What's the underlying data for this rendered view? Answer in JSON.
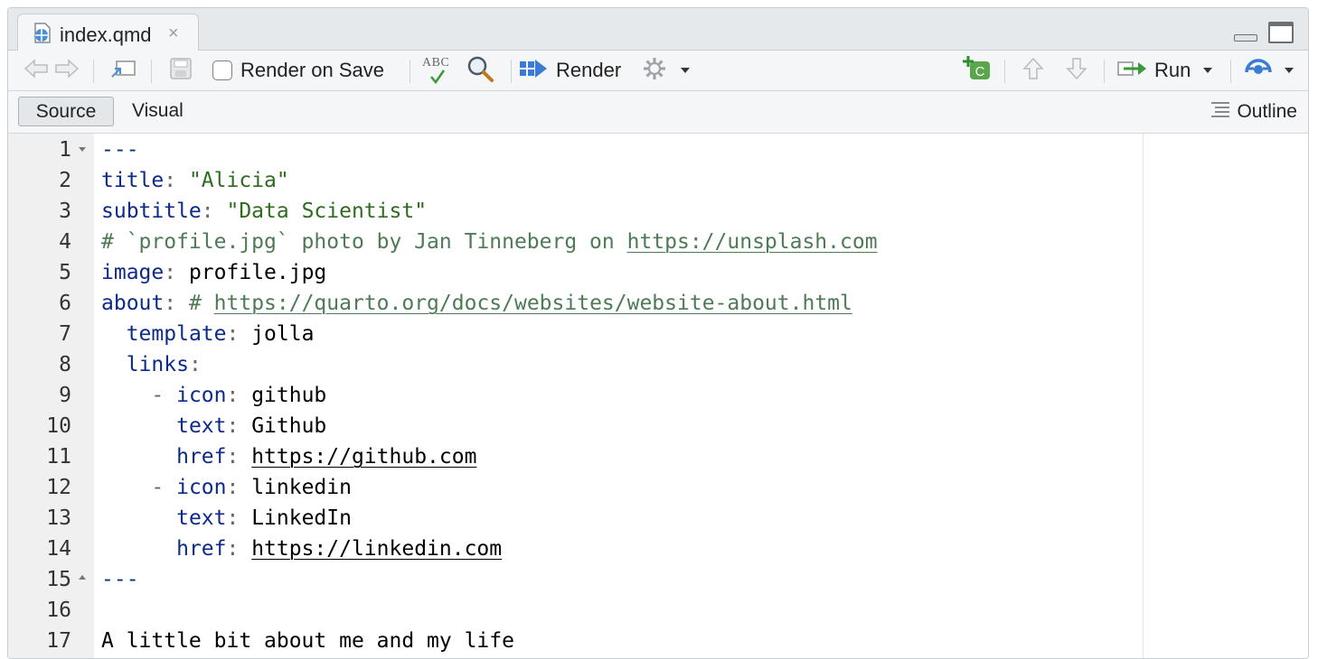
{
  "tab": {
    "title": "index.qmd",
    "close": "×"
  },
  "toolbar": {
    "render_on_save": "Render on Save",
    "spell_abc": "ABC",
    "render": "Render",
    "run": "Run"
  },
  "modebar": {
    "source": "Source",
    "visual": "Visual",
    "outline": "Outline"
  },
  "editor": {
    "line_numbers": [
      "1",
      "2",
      "3",
      "4",
      "5",
      "6",
      "7",
      "8",
      "9",
      "10",
      "11",
      "12",
      "13",
      "14",
      "15",
      "16",
      "17"
    ],
    "lines": {
      "l1": "---",
      "l2_key": "title",
      "l2_val": "\"Alicia\"",
      "l3_key": "subtitle",
      "l3_val": "\"Data Scientist\"",
      "l4_comment": "# `profile.jpg` photo by Jan Tinneberg on ",
      "l4_url": "https://unsplash.com",
      "l5_key": "image",
      "l5_val": "profile.jpg",
      "l6_key": "about",
      "l6_comment": "# ",
      "l6_url": "https://quarto.org/docs/websites/website-about.html",
      "l7_key": "template",
      "l7_val": "jolla",
      "l8_key": "links",
      "l9_key": "icon",
      "l9_val": "github",
      "l10_key": "text",
      "l10_val": "Github",
      "l11_key": "href",
      "l11_val": "https://github.com",
      "l12_key": "icon",
      "l12_val": "linkedin",
      "l13_key": "text",
      "l13_val": "LinkedIn",
      "l14_key": "href",
      "l14_val": "https://linkedin.com",
      "l15": "---",
      "l17": "A little bit about me and my life"
    }
  },
  "icons": [
    "document-icon",
    "back-arrow-icon",
    "forward-arrow-icon",
    "show-in-window-icon",
    "save-icon",
    "spellcheck-icon",
    "search-icon",
    "render-icon",
    "gear-icon",
    "insert-chunk-icon",
    "up-arrow-icon",
    "down-arrow-icon",
    "run-icon",
    "publish-icon",
    "outline-icon",
    "minimize-icon",
    "maximize-icon"
  ],
  "colors": {
    "keyword": "#0c2a8a",
    "string": "#2f6b1e",
    "comment": "#4e7a55",
    "chunk_green": "#5aa64a",
    "render_blue": "#3a7bd5"
  }
}
